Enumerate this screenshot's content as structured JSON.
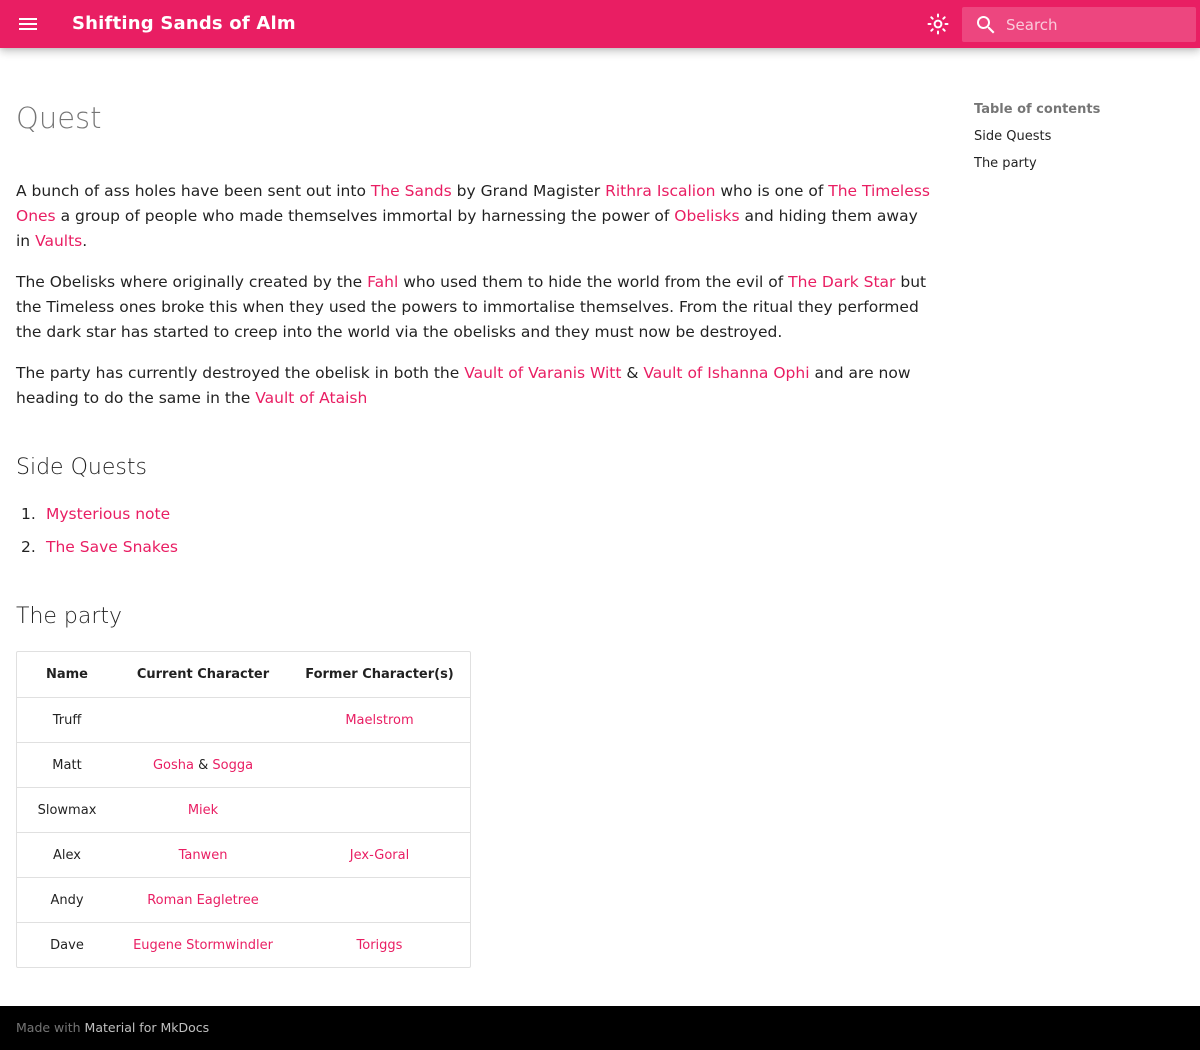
{
  "header": {
    "site_title": "Shifting Sands of Alm",
    "search_placeholder": "Search"
  },
  "page": {
    "title": "Quest",
    "paragraph1": {
      "t1": "A bunch of ass holes have been sent out into ",
      "l1": "The Sands",
      "t2": " by Grand Magister ",
      "l2": "Rithra Iscalion",
      "t3": " who is one of ",
      "l3": "The Timeless Ones",
      "t4": " a group of people who made themselves immortal by harnessing the power of ",
      "l4": "Obelisks",
      "t5": " and hiding them away in ",
      "l5": "Vaults",
      "t6": "."
    },
    "paragraph2": {
      "t1": "The Obelisks where originally created by the ",
      "l1": "Fahl",
      "t2": " who used them to hide the world from the evil of ",
      "l2": "The Dark Star",
      "t3": " but the Timeless ones broke this when they used the powers to immortalise themselves. From the ritual they performed the dark star has started to creep into the world via the obelisks and they must now be destroyed."
    },
    "paragraph3": {
      "t1": "The party has currently destroyed the obelisk in both the ",
      "l1": "Vault of Varanis Witt",
      "t2": " & ",
      "l2": "Vault of Ishanna Ophi",
      "t3": " and are now heading to do the same in the ",
      "l3": "Vault of Ataish"
    },
    "side_quests_heading": "Side Quests",
    "side_quests": [
      {
        "num": "1.",
        "label": "Mysterious note"
      },
      {
        "num": "2.",
        "label": "The Save Snakes"
      }
    ],
    "party_heading": "The party",
    "table": {
      "headers": [
        "Name",
        "Current Character",
        "Former Character(s)"
      ],
      "rows": [
        {
          "name": "Truff",
          "current": "",
          "current_amp": "",
          "current2": "",
          "former": "Maelstrom"
        },
        {
          "name": "Matt",
          "current": "Gosha",
          "current_amp": " & ",
          "current2": "Sogga",
          "former": ""
        },
        {
          "name": "Slowmax",
          "current": "Miek",
          "current_amp": "",
          "current2": "",
          "former": ""
        },
        {
          "name": "Alex",
          "current": "Tanwen",
          "current_amp": "",
          "current2": "",
          "former": "Jex-Goral"
        },
        {
          "name": "Andy",
          "current": "Roman Eagletree",
          "current_amp": "",
          "current2": "",
          "former": ""
        },
        {
          "name": "Dave",
          "current": "Eugene Stormwindler",
          "current_amp": "",
          "current2": "",
          "former": "Toriggs"
        }
      ]
    }
  },
  "toc": {
    "title": "Table of contents",
    "items": [
      "Side Quests",
      "The party"
    ]
  },
  "footer": {
    "made_with": "Made with ",
    "link": "Material for MkDocs"
  },
  "colors": {
    "primary": "#e91e63",
    "footer_bg": "#000000"
  },
  "icons": {
    "menu": "menu-icon",
    "theme": "brightness-icon",
    "search": "search-icon"
  }
}
